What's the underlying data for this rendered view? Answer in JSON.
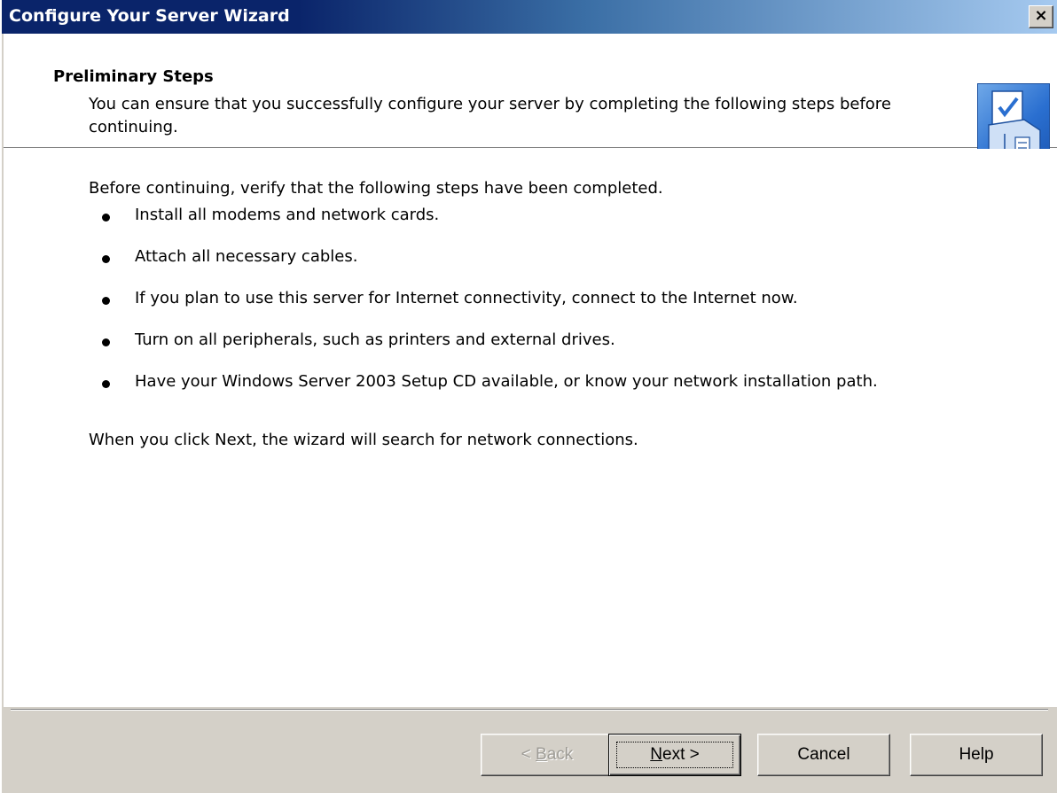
{
  "window": {
    "title": "Configure Your Server Wizard",
    "close_glyph": "×",
    "close_icon": "close-icon"
  },
  "header": {
    "title": "Preliminary Steps",
    "subtitle": "You can ensure that you successfully configure your server by completing the following steps before continuing.",
    "icon": "wizard-checklist-icon"
  },
  "content": {
    "intro": "Before continuing, verify that the following steps have been completed.",
    "steps": [
      "Install all modems and network cards.",
      "Attach all necessary cables.",
      "If you plan to use this server for Internet connectivity, connect to the Internet now.",
      "Turn on all peripherals, such as printers and external drives.",
      "Have your Windows Server 2003 Setup CD available, or know your network installation path."
    ],
    "outro": "When you click Next, the wizard will search for network connections."
  },
  "buttons": {
    "back": {
      "prefix": "< ",
      "accel": "B",
      "rest": "ack",
      "enabled": false
    },
    "next": {
      "accel": "N",
      "rest": "ext >",
      "enabled": true
    },
    "cancel": "Cancel",
    "help": "Help"
  },
  "colors": {
    "title_bar_start": "#0a246a",
    "title_bar_end": "#a6caf0",
    "dialog_face": "#d4d0c8"
  }
}
